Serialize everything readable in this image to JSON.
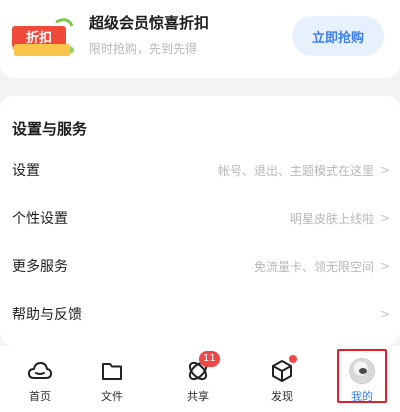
{
  "promo": {
    "badge_text": "折扣",
    "title": "超级会员惊喜折扣",
    "subtitle": "限时抢购，先到先得",
    "button": "立即抢购"
  },
  "settings": {
    "section_title": "设置与服务",
    "rows": [
      {
        "label": "设置",
        "desc": "帐号、退出、主题模式在这里"
      },
      {
        "label": "个性设置",
        "desc": "明星皮肤上线啦"
      },
      {
        "label": "更多服务",
        "desc": "免流量卡、领无限空间"
      },
      {
        "label": "帮助与反馈",
        "desc": ""
      }
    ],
    "chevron": ">"
  },
  "tabbar": {
    "tabs": [
      {
        "label": "首页",
        "icon": "cloud-icon"
      },
      {
        "label": "文件",
        "icon": "folder-icon"
      },
      {
        "label": "共享",
        "icon": "share-icon",
        "badge": "11"
      },
      {
        "label": "发现",
        "icon": "cube-icon"
      },
      {
        "label": "我的",
        "icon": "avatar-icon"
      }
    ],
    "active_tab": "我的"
  },
  "colors": {
    "accent_blue": "#3b7ef0",
    "badge_red": "#ef4747",
    "highlight_red": "#e0202a"
  }
}
